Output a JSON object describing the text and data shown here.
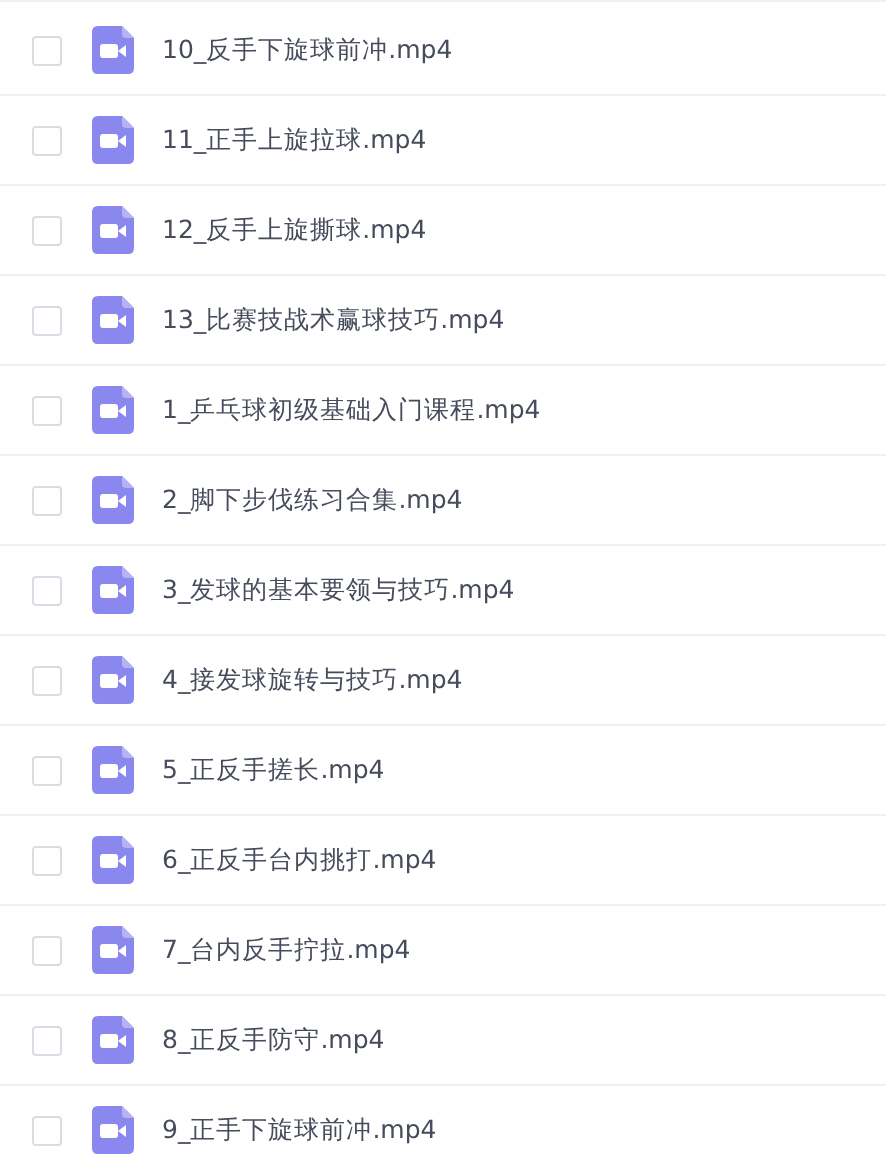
{
  "files": [
    {
      "name": "10_反手下旋球前冲.mp4",
      "checked": false
    },
    {
      "name": "11_正手上旋拉球.mp4",
      "checked": false
    },
    {
      "name": "12_反手上旋撕球.mp4",
      "checked": false
    },
    {
      "name": "13_比赛技战术赢球技巧.mp4",
      "checked": false
    },
    {
      "name": "1_乒乓球初级基础入门课程.mp4",
      "checked": false
    },
    {
      "name": "2_脚下步伐练习合集.mp4",
      "checked": false
    },
    {
      "name": "3_发球的基本要领与技巧.mp4",
      "checked": false
    },
    {
      "name": "4_接发球旋转与技巧.mp4",
      "checked": false
    },
    {
      "name": "5_正反手搓长.mp4",
      "checked": false
    },
    {
      "name": "6_正反手台内挑打.mp4",
      "checked": false
    },
    {
      "name": "7_台内反手拧拉.mp4",
      "checked": false
    },
    {
      "name": "8_正反手防守.mp4",
      "checked": false
    },
    {
      "name": "9_正手下旋球前冲.mp4",
      "checked": false
    }
  ]
}
